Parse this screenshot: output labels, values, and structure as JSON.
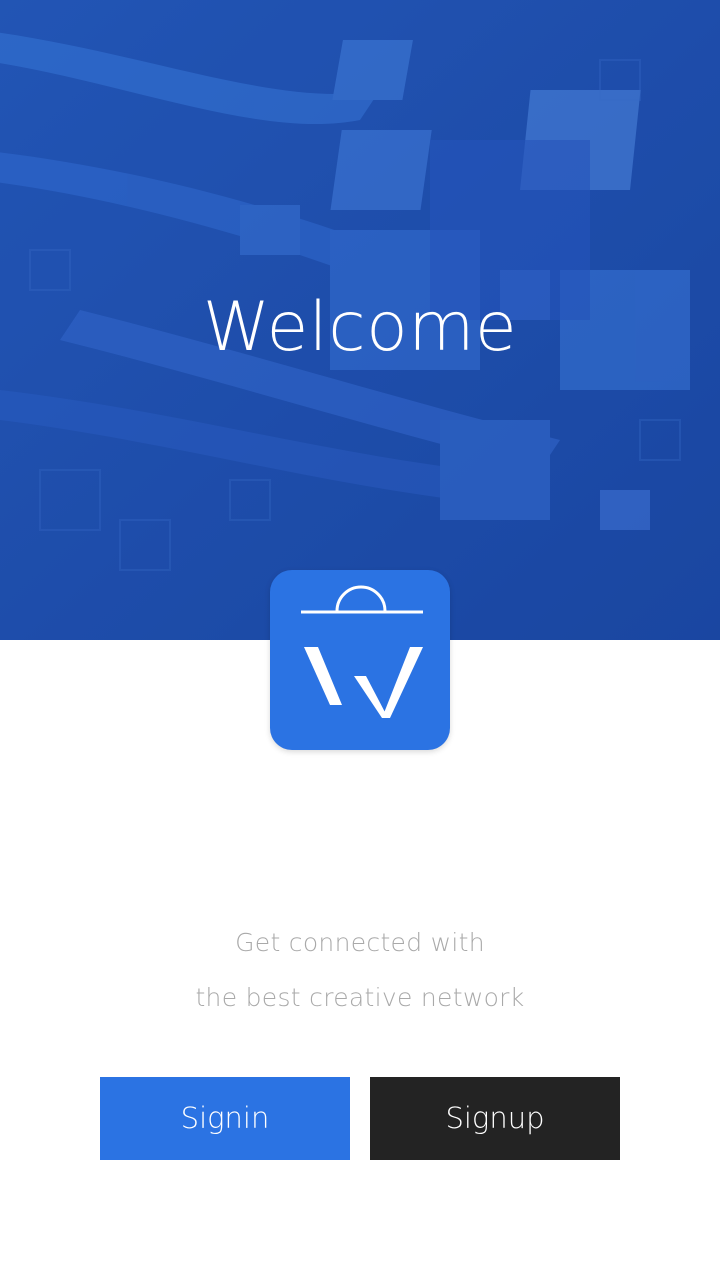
{
  "hero": {
    "title": "Welcome",
    "background_color": "#1f4fa8"
  },
  "logo": {
    "icon": "shopping-bag-w-logo-icon",
    "color": "#2b73e3"
  },
  "tagline": {
    "line1": "Get connected with",
    "line2": "the best creative network"
  },
  "buttons": {
    "signin_label": "Signin",
    "signup_label": "Signup",
    "signin_color": "#2b73e3",
    "signup_color": "#232323"
  }
}
